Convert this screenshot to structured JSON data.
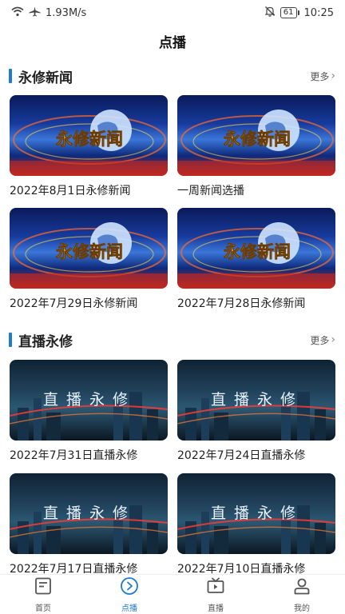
{
  "status_bar": {
    "network_speed": "1.93M/s",
    "battery": "61",
    "time": "10:25"
  },
  "header": {
    "title": "点播"
  },
  "sections": [
    {
      "title": "永修新闻",
      "more_label": "更多",
      "thumb_overlay": "永修新闻",
      "items": [
        {
          "caption": "2022年8月1日永修新闻"
        },
        {
          "caption": "一周新闻选播"
        },
        {
          "caption": "2022年7月29日永修新闻"
        },
        {
          "caption": "2022年7月28日永修新闻"
        }
      ]
    },
    {
      "title": "直播永修",
      "more_label": "更多",
      "thumb_overlay": "直播永修",
      "items": [
        {
          "caption": "2022年7月31日直播永修"
        },
        {
          "caption": "2022年7月24日直播永修"
        },
        {
          "caption": "2022年7月17日直播永修"
        },
        {
          "caption": "2022年7月10日直播永修"
        }
      ]
    }
  ],
  "bottom_nav": {
    "items": [
      {
        "label": "首页",
        "icon": "home-doc-icon"
      },
      {
        "label": "点播",
        "icon": "play-circle-icon"
      },
      {
        "label": "直播",
        "icon": "tv-icon"
      },
      {
        "label": "我的",
        "icon": "person-icon"
      }
    ],
    "active_index": 1
  },
  "colors": {
    "accent": "#1f7ad4",
    "text": "#222222"
  }
}
